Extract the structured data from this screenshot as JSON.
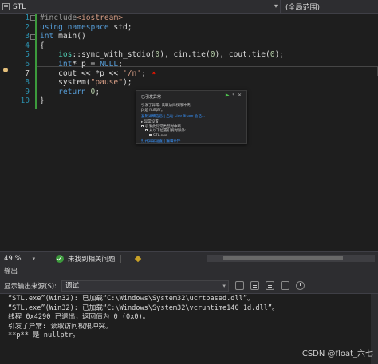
{
  "navbar": {
    "project": "STL",
    "scope": "(全局范围)"
  },
  "editor": {
    "line_numbers": [
      "1",
      "2",
      "3",
      "4",
      "5",
      "6",
      "7",
      "8",
      "9",
      "10"
    ],
    "current_line": "7",
    "code_lines": [
      [
        {
          "t": "#include",
          "c": "pp"
        },
        {
          "t": "<iostream>",
          "c": "inc"
        }
      ],
      [
        {
          "t": "using",
          "c": "kw"
        },
        {
          "t": " "
        },
        {
          "t": "namespace",
          "c": "kw"
        },
        {
          "t": " std;"
        }
      ],
      [
        {
          "t": "int",
          "c": "kw"
        },
        {
          "t": " main()"
        }
      ],
      [
        {
          "t": "{"
        }
      ],
      [
        {
          "t": "    "
        },
        {
          "t": "ios",
          "c": "ns"
        },
        {
          "t": "::sync_with_stdio("
        },
        {
          "t": "0",
          "c": "num"
        },
        {
          "t": "), cin.tie("
        },
        {
          "t": "0",
          "c": "num"
        },
        {
          "t": "), cout.tie("
        },
        {
          "t": "0",
          "c": "num"
        },
        {
          "t": ");"
        }
      ],
      [
        {
          "t": "    "
        },
        {
          "t": "int",
          "c": "kw"
        },
        {
          "t": "* p = "
        },
        {
          "t": "NULL",
          "c": "kw"
        },
        {
          "t": ";"
        }
      ],
      [
        {
          "t": "    cout << *p << "
        },
        {
          "t": "'/n'",
          "c": "str"
        },
        {
          "t": ";"
        }
      ],
      [
        {
          "t": "    system("
        },
        {
          "t": "\"pause\"",
          "c": "str"
        },
        {
          "t": ");"
        }
      ],
      [
        {
          "t": "    "
        },
        {
          "t": "return",
          "c": "kw"
        },
        {
          "t": " "
        },
        {
          "t": "0",
          "c": "num"
        },
        {
          "t": ";"
        }
      ],
      [
        {
          "t": "}"
        }
      ]
    ]
  },
  "exception_popup": {
    "title": "已引发异常",
    "message": "引发了异常: 读取访问权限冲突。",
    "detail": "p 是 nullptr。",
    "links": "复制详细信息 | 启动 Live Share 会话...",
    "settings_label": "▸ 异常设置",
    "option_1": "引发此异常类型时中断",
    "option_2": "从以下位置引发时除外:",
    "option_3": "STL.exe",
    "footer": "打开异常设置 | 编辑条件"
  },
  "status": {
    "zoom": "49 %",
    "issues": "未找到相关问题"
  },
  "output": {
    "title": "输出",
    "source_label": "显示输出来源(S):",
    "source_value": "调试",
    "lines": [
      "“STL.exe”(Win32): 已加载“C:\\Windows\\System32\\ucrtbased.dll”。",
      "“STL.exe”(Win32): 已加载“C:\\Windows\\System32\\vcruntime140_1d.dll”。",
      "线程 0x4290 已退出，返回值为 0 (0x0)。",
      "引发了异常: 读取访问权限冲突。",
      "**p** 是 nullptr。"
    ],
    "watermark": "CSDN @float_六七"
  }
}
